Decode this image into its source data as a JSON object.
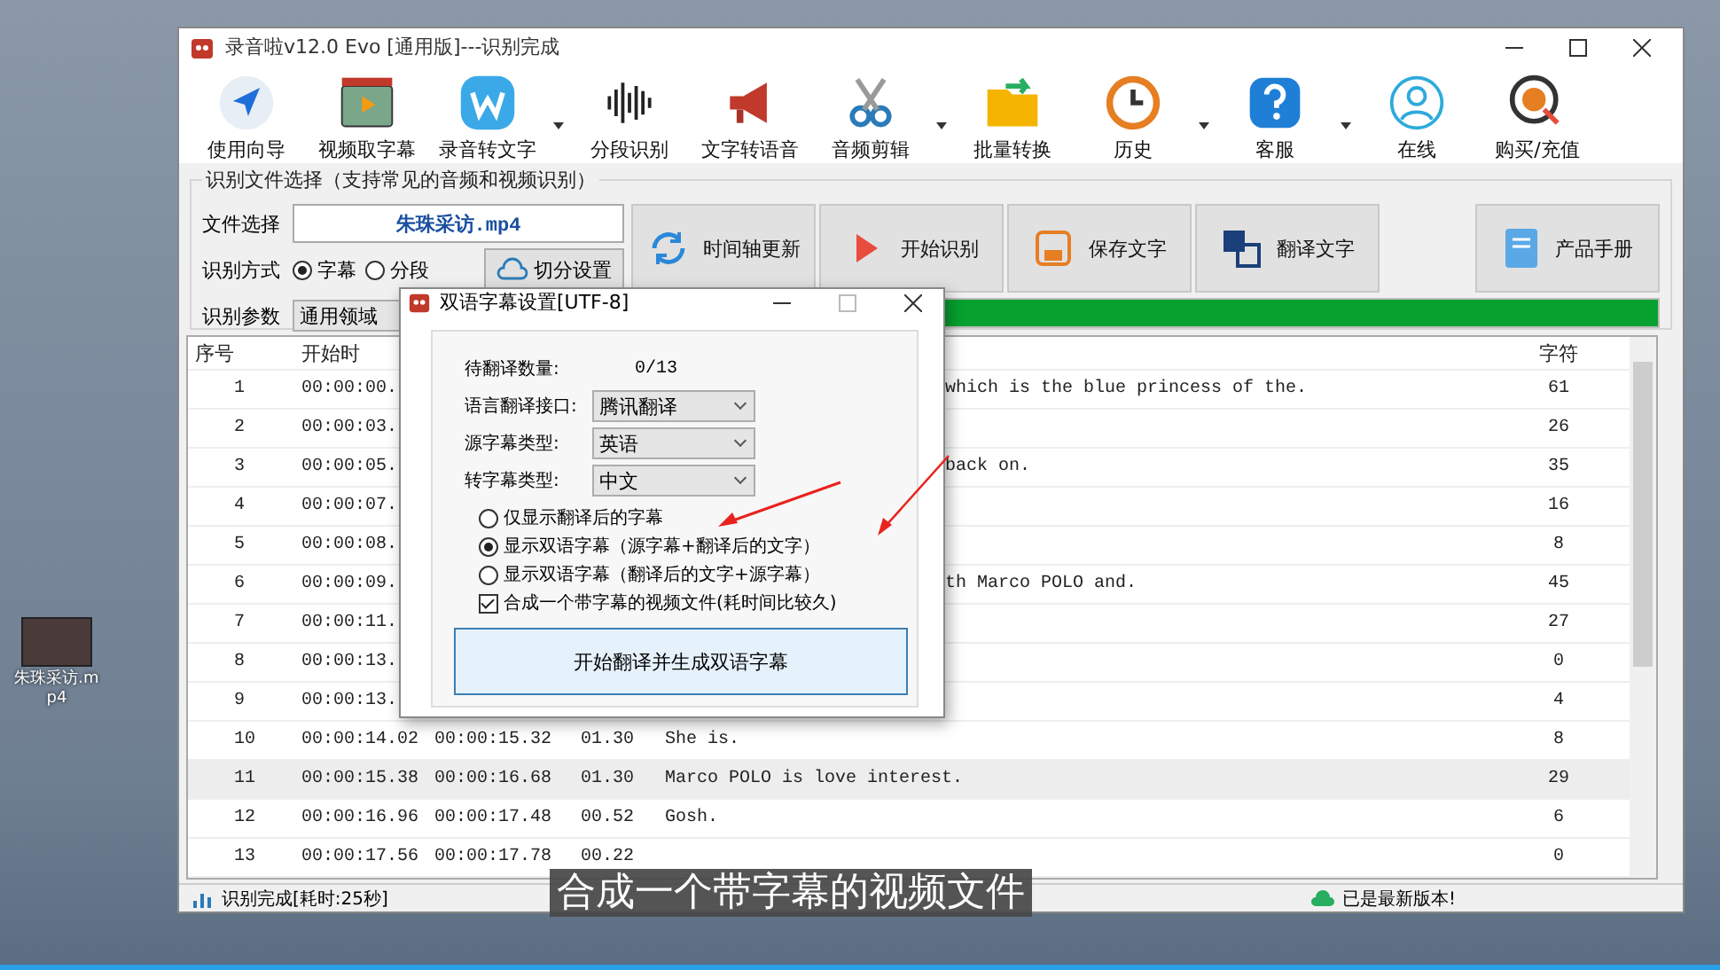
{
  "desktop": {
    "file_label": "朱珠采访.mp4"
  },
  "window": {
    "title": "录音啦v12.0 Evo [通用版]---识别完成"
  },
  "toolbar": [
    {
      "label": "使用向导",
      "dropdown": false
    },
    {
      "label": "视频取字幕",
      "dropdown": false
    },
    {
      "label": "录音转文字",
      "dropdown": true
    },
    {
      "label": "分段识别",
      "dropdown": false
    },
    {
      "label": "文字转语音",
      "dropdown": false
    },
    {
      "label": "音频剪辑",
      "dropdown": true
    },
    {
      "label": "批量转换",
      "dropdown": false
    },
    {
      "label": "历史",
      "dropdown": true
    },
    {
      "label": "客服",
      "dropdown": true
    },
    {
      "label": "在线",
      "dropdown": false
    },
    {
      "label": "购买/充值",
      "dropdown": false
    }
  ],
  "file_panel": {
    "title": "识别文件选择（支持常见的音频和视频识别）",
    "file_label": "文件选择",
    "file_name": "朱珠采访.mp4",
    "mode_label": "识别方式",
    "modes": [
      {
        "label": "字幕",
        "selected": true
      },
      {
        "label": "分段",
        "selected": false
      }
    ],
    "split_button": "切分设置",
    "params_label": "识别参数",
    "params_value": "通用领域",
    "actions": [
      "时间轴更新",
      "开始识别",
      "保存文字",
      "翻译文字"
    ],
    "manual_button": "产品手册",
    "progress": {
      "level": 1
    }
  },
  "table": {
    "columns": [
      "序号",
      "开始时",
      "字符"
    ],
    "rows": [
      {
        "index": "1",
        "start": "00:00:00.",
        "text": "which is the blue princess of the.",
        "chars": "61",
        "selected": false
      },
      {
        "index": "2",
        "start": "00:00:03.",
        "chars": "26",
        "selected": false
      },
      {
        "index": "3",
        "start": "00:00:05.",
        "text": "back on.",
        "chars": "35",
        "selected": false
      },
      {
        "index": "4",
        "start": "00:00:07.",
        "chars": "16",
        "selected": false
      },
      {
        "index": "5",
        "start": "00:00:08.",
        "chars": "8",
        "selected": false
      },
      {
        "index": "6",
        "start": "00:00:09.",
        "text": "th Marco POLO and.",
        "chars": "45",
        "selected": false
      },
      {
        "index": "7",
        "start": "00:00:11.",
        "chars": "27",
        "selected": false
      },
      {
        "index": "8",
        "start": "00:00:13.",
        "chars": "0",
        "selected": false
      },
      {
        "index": "9",
        "start": "00:00:13.",
        "chars": "4",
        "selected": false
      },
      {
        "index": "10",
        "start": "00:00:14.02",
        "end": "00:00:15.32",
        "duration": "01.30",
        "text": "She is.",
        "chars": "8",
        "selected": false
      },
      {
        "index": "11",
        "start": "00:00:15.38",
        "end": "00:00:16.68",
        "duration": "01.30",
        "text": "Marco POLO is love interest.",
        "chars": "29",
        "selected": true
      },
      {
        "index": "12",
        "start": "00:00:16.96",
        "end": "00:00:17.48",
        "duration": "00.52",
        "text": "Gosh.",
        "chars": "6",
        "selected": false
      },
      {
        "index": "13",
        "start": "00:00:17.56",
        "end": "00:00:17.78",
        "duration": "00.22",
        "chars": "0",
        "selected": false
      }
    ]
  },
  "status_bar": {
    "message": "识别完成[耗时:25秒]",
    "version": "已是最新版本!"
  },
  "dialog": {
    "title": "双语字幕设置[UTF-8]",
    "count_label": "待翻译数量:",
    "count_value": "0/13",
    "selects": [
      {
        "label": "语言翻译接口:",
        "value": "腾讯翻译"
      },
      {
        "label": "源字幕类型:",
        "value": "英语"
      },
      {
        "label": "转字幕类型:",
        "value": "中文"
      }
    ],
    "options": [
      {
        "label": "仅显示翻译后的字幕",
        "selected": false
      },
      {
        "label": "显示双语字幕（源字幕+翻译后的文字）",
        "selected": true
      },
      {
        "label": "显示双语字幕（翻译后的文字+源字幕）",
        "selected": false
      }
    ],
    "merge": {
      "label": "合成一个带字幕的视频文件(耗时间比较久)",
      "checked": true
    },
    "button": "开始翻译并生成双语字幕"
  },
  "caption": "合成一个带字幕的视频文件"
}
